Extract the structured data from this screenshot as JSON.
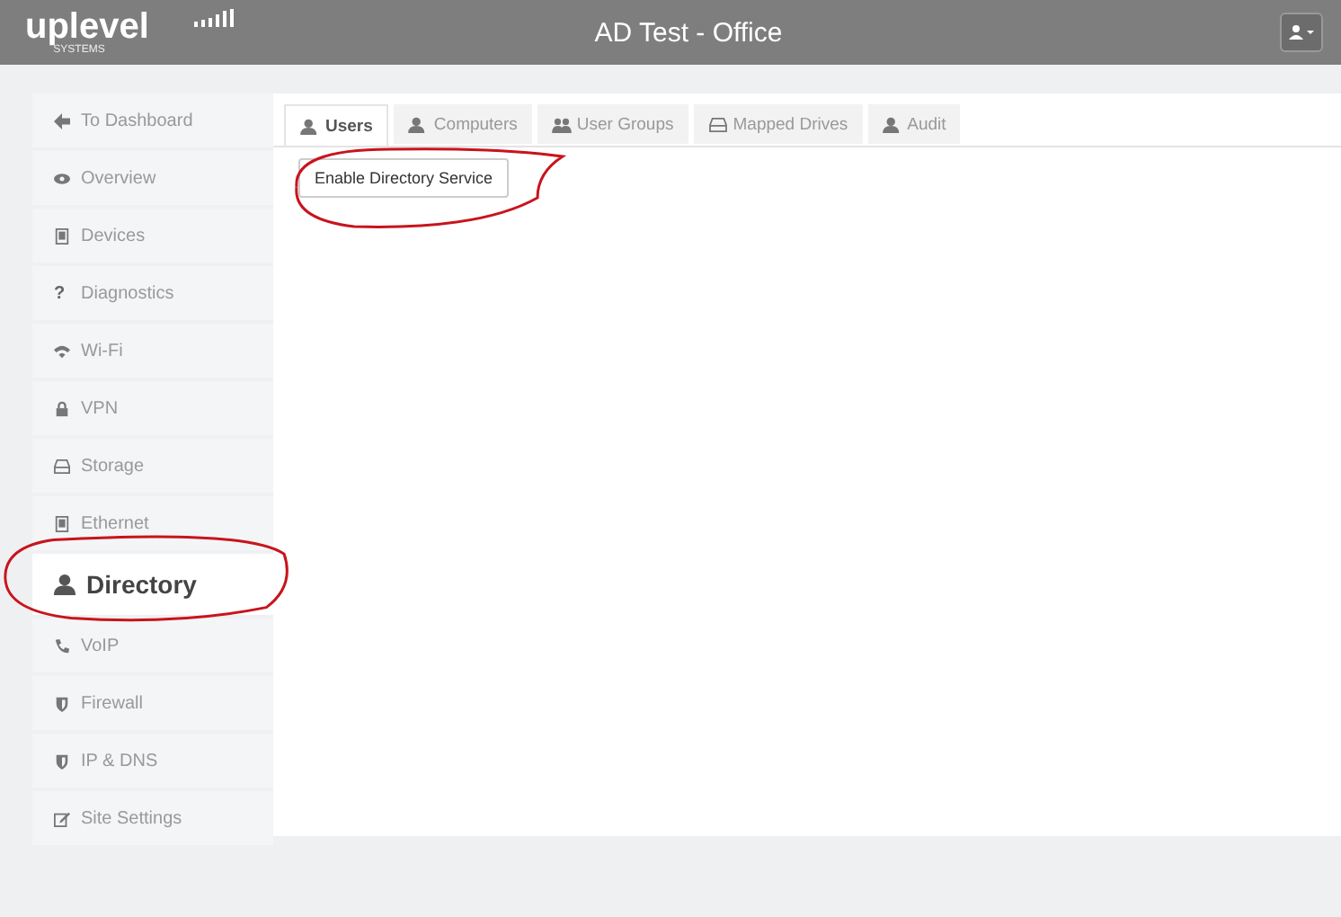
{
  "header": {
    "logo": "uplevel",
    "logo_sub": "SYSTEMS",
    "title": "AD Test - Office"
  },
  "sidebar": {
    "items": [
      {
        "label": "To Dashboard",
        "kind": "arrow",
        "selected": false
      },
      {
        "label": "Overview",
        "kind": "eye",
        "selected": false
      },
      {
        "label": "Devices",
        "kind": "tablet",
        "selected": false
      },
      {
        "label": "Diagnostics",
        "kind": "glyph",
        "glyph": "?",
        "selected": false
      },
      {
        "label": "Wi-Fi",
        "kind": "wifi",
        "selected": false
      },
      {
        "label": "VPN",
        "kind": "lock",
        "selected": false
      },
      {
        "label": "Storage",
        "kind": "drive",
        "selected": false
      },
      {
        "label": "Ethernet",
        "kind": "tablet",
        "selected": false
      },
      {
        "label": "Directory",
        "kind": "user",
        "selected": true
      },
      {
        "label": "VoIP",
        "kind": "phone",
        "selected": false
      },
      {
        "label": "Firewall",
        "kind": "shield",
        "selected": false
      },
      {
        "label": "IP & DNS",
        "kind": "shield",
        "selected": false
      },
      {
        "label": "Site Settings",
        "kind": "edit",
        "selected": false
      }
    ]
  },
  "tabs": [
    {
      "label": "Users",
      "kind": "user",
      "selected": true
    },
    {
      "label": "Computers",
      "kind": "user",
      "selected": false
    },
    {
      "label": "User Groups",
      "kind": "users",
      "selected": false
    },
    {
      "label": "Mapped Drives",
      "kind": "drive",
      "selected": false
    },
    {
      "label": "Audit",
      "kind": "user",
      "selected": false
    }
  ],
  "action_button": "Enable Directory Service"
}
